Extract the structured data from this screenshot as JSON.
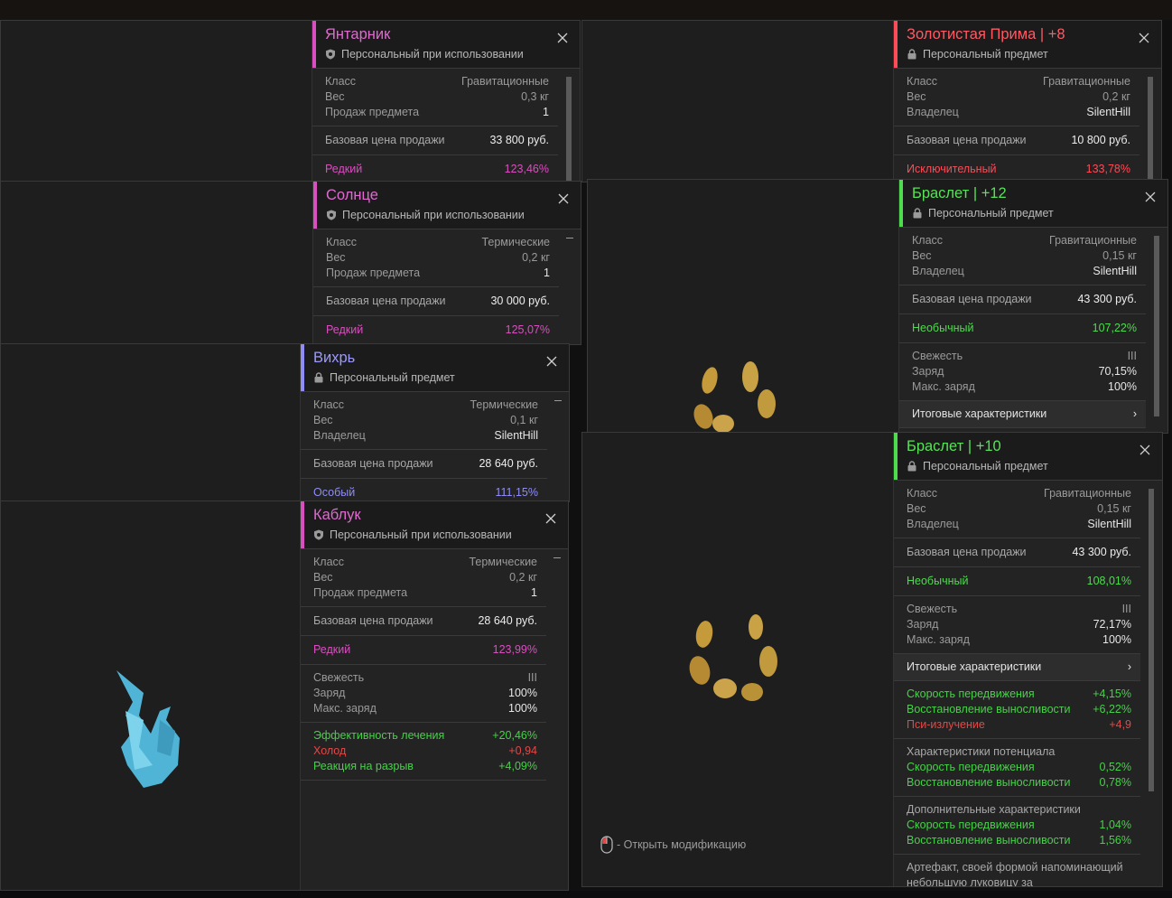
{
  "colors": {
    "rare": "#d94fbf",
    "special": "#8f8df5",
    "uncommon": "#4ddc4d",
    "exceptional": "#ff4b57",
    "positive": "#46d148",
    "negative": "#e24848"
  },
  "icons": {
    "shield": "shield-icon",
    "lock": "lock-icon",
    "close": "close-icon",
    "chevron": "chevron-right-icon",
    "mouse": "mouse-icon"
  },
  "windows": {
    "yantarnik": {
      "title": "Янтарник",
      "subtitle": "Персональный при использовании",
      "stats": [
        {
          "k": "Класс",
          "v": "Гравитационные"
        },
        {
          "k": "Вес",
          "v": "0,3 кг"
        },
        {
          "k": "Продаж предмета",
          "v": "1"
        }
      ],
      "price": {
        "k": "Базовая цена продажи",
        "v": "33 800 руб."
      },
      "rarity": {
        "k": "Редкий",
        "v": "123,46%"
      }
    },
    "solntse": {
      "title": "Солнце",
      "subtitle": "Персональный при использовании",
      "stats": [
        {
          "k": "Класс",
          "v": "Термические"
        },
        {
          "k": "Вес",
          "v": "0,2 кг"
        },
        {
          "k": "Продаж предмета",
          "v": "1"
        }
      ],
      "price": {
        "k": "Базовая цена продажи",
        "v": "30 000 руб."
      },
      "rarity": {
        "k": "Редкий",
        "v": "125,07%"
      }
    },
    "vikhr": {
      "title": "Вихрь",
      "subtitle": "Персональный предмет",
      "stats": [
        {
          "k": "Класс",
          "v": "Термические"
        },
        {
          "k": "Вес",
          "v": "0,1 кг"
        },
        {
          "k": "Владелец",
          "v": "SilentHill"
        }
      ],
      "price": {
        "k": "Базовая цена продажи",
        "v": "28 640 руб."
      },
      "rarity": {
        "k": "Особый",
        "v": "111,15%"
      }
    },
    "kabluk": {
      "title": "Каблук",
      "subtitle": "Персональный при использовании",
      "stats": [
        {
          "k": "Класс",
          "v": "Термические"
        },
        {
          "k": "Вес",
          "v": "0,2 кг"
        },
        {
          "k": "Продаж предмета",
          "v": "1"
        }
      ],
      "price": {
        "k": "Базовая цена продажи",
        "v": "28 640 руб."
      },
      "rarity": {
        "k": "Редкий",
        "v": "123,99%"
      },
      "charge": [
        {
          "k": "Свежесть",
          "v": "III"
        },
        {
          "k": "Заряд",
          "v": "100%"
        },
        {
          "k": "Макс. заряд",
          "v": "100%"
        }
      ],
      "effects": [
        {
          "k": "Эффективность лечения",
          "v": "+20,46%"
        },
        {
          "k": "Холод",
          "v": "+0,94"
        },
        {
          "k": "Реакция на разрыв",
          "v": "+4,09%"
        }
      ]
    },
    "prima": {
      "title": "Золотистая Прима | +8",
      "subtitle": "Персональный предмет",
      "stats": [
        {
          "k": "Класс",
          "v": "Гравитационные"
        },
        {
          "k": "Вес",
          "v": "0,2 кг"
        },
        {
          "k": "Владелец",
          "v": "SilentHill"
        }
      ],
      "price": {
        "k": "Базовая цена продажи",
        "v": "10 800 руб."
      },
      "rarity": {
        "k": "Исключительный",
        "v": "133,78%"
      }
    },
    "braslet12": {
      "title": "Браслет | +12",
      "subtitle": "Персональный предмет",
      "stats": [
        {
          "k": "Класс",
          "v": "Гравитационные"
        },
        {
          "k": "Вес",
          "v": "0,15 кг"
        },
        {
          "k": "Владелец",
          "v": "SilentHill"
        }
      ],
      "price": {
        "k": "Базовая цена продажи",
        "v": "43 300 руб."
      },
      "rarity": {
        "k": "Необычный",
        "v": "107,22%"
      },
      "charge": [
        {
          "k": "Свежесть",
          "v": "III"
        },
        {
          "k": "Заряд",
          "v": "70,15%"
        },
        {
          "k": "Макс. заряд",
          "v": "100%"
        }
      ],
      "summary": "Итоговые характеристики"
    },
    "braslet10": {
      "title": "Браслет | +10",
      "subtitle": "Персональный предмет",
      "stats": [
        {
          "k": "Класс",
          "v": "Гравитационные"
        },
        {
          "k": "Вес",
          "v": "0,15 кг"
        },
        {
          "k": "Владелец",
          "v": "SilentHill"
        }
      ],
      "price": {
        "k": "Базовая цена продажи",
        "v": "43 300 руб."
      },
      "rarity": {
        "k": "Необычный",
        "v": "108,01%"
      },
      "charge": [
        {
          "k": "Свежесть",
          "v": "III"
        },
        {
          "k": "Заряд",
          "v": "72,17%"
        },
        {
          "k": "Макс. заряд",
          "v": "100%"
        }
      ],
      "summary": "Итоговые характеристики",
      "effects": [
        {
          "k": "Скорость передвижения",
          "v": "+4,15%"
        },
        {
          "k": "Восстановление выносливости",
          "v": "+6,22%"
        },
        {
          "k": "Пси-излучение",
          "v": "+4,9"
        }
      ],
      "potential_heading": "Характеристики потенциала",
      "potential": [
        {
          "k": "Скорость передвижения",
          "v": "0,52%"
        },
        {
          "k": "Восстановление выносливости",
          "v": "0,78%"
        }
      ],
      "extra_heading": "Дополнительные характеристики",
      "extra": [
        {
          "k": "Скорость передвижения",
          "v": "1,04%"
        },
        {
          "k": "Восстановление выносливости",
          "v": "1,56%"
        }
      ],
      "description": "Артефакт, своей формой напоминающий небольшую луковицу за",
      "hint": "- Открыть модификацию"
    }
  }
}
